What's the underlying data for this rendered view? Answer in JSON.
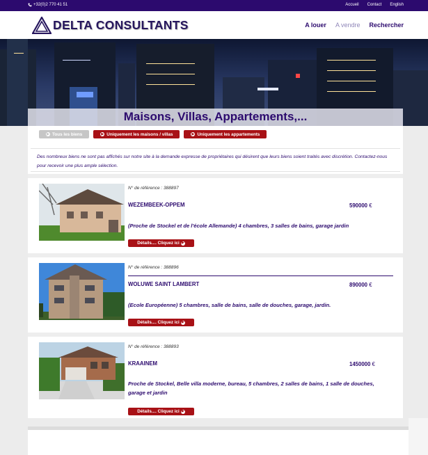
{
  "topbar": {
    "phone": "+32(0)2 770 41 51",
    "links": [
      "Accueil",
      "Contact",
      "English"
    ]
  },
  "brand": {
    "name": "DELTA CONSULTANTS",
    "color": "#27175e"
  },
  "nav": {
    "items": [
      "A louer",
      "A vendre",
      "Rechercher"
    ],
    "active": "A vendre"
  },
  "hero": {
    "title": "Maisons, Villas, Appartements,..."
  },
  "filters": [
    {
      "label": "Tous les biens",
      "style": "grey"
    },
    {
      "label": "Uniquement les maisons / villas",
      "style": "red"
    },
    {
      "label": "Uniquement les appartements",
      "style": "red"
    }
  ],
  "notice": "Des nombreux biens ne sont pas affichés sur notre site à la demande expresse de propriétaires qui désirent que leurs biens soient traités avec discrétion. Contactez-nous pour recevoir une plus ample sélection.",
  "listings": [
    {
      "ref": "N° de référence : 388897",
      "city": "WEZEMBEEK-OPPEM",
      "price": "590000",
      "currency": "€",
      "description": "(Proche de Stockel et de l'école Allemande) 4 chambres, 3 salles de bains, garage jardin",
      "details_label": "Détails.... Cliquez ici"
    },
    {
      "ref": "N° de référence : 388896",
      "city": "WOLUWE SAINT LAMBERT",
      "price": "890000",
      "currency": "€",
      "description": "(Ecole Européenne) 5 chambres, salle de bains, salle de douches, garage, jardin.",
      "details_label": "Détails.... Cliquez ici"
    },
    {
      "ref": "N° de référence : 388893",
      "city": "KRAAINEM",
      "price": "1450000",
      "currency": "€",
      "description": "Proche de Stockel, Belle villa moderne, bureau, 5 chambres, 2 salles de bains, 1 salle de douches, garage et jardin",
      "details_label": "Détails.... Cliquez ici"
    }
  ],
  "colors": {
    "primary": "#2c0a6e",
    "accent": "#a81116",
    "muted": "#c6c6c6"
  }
}
